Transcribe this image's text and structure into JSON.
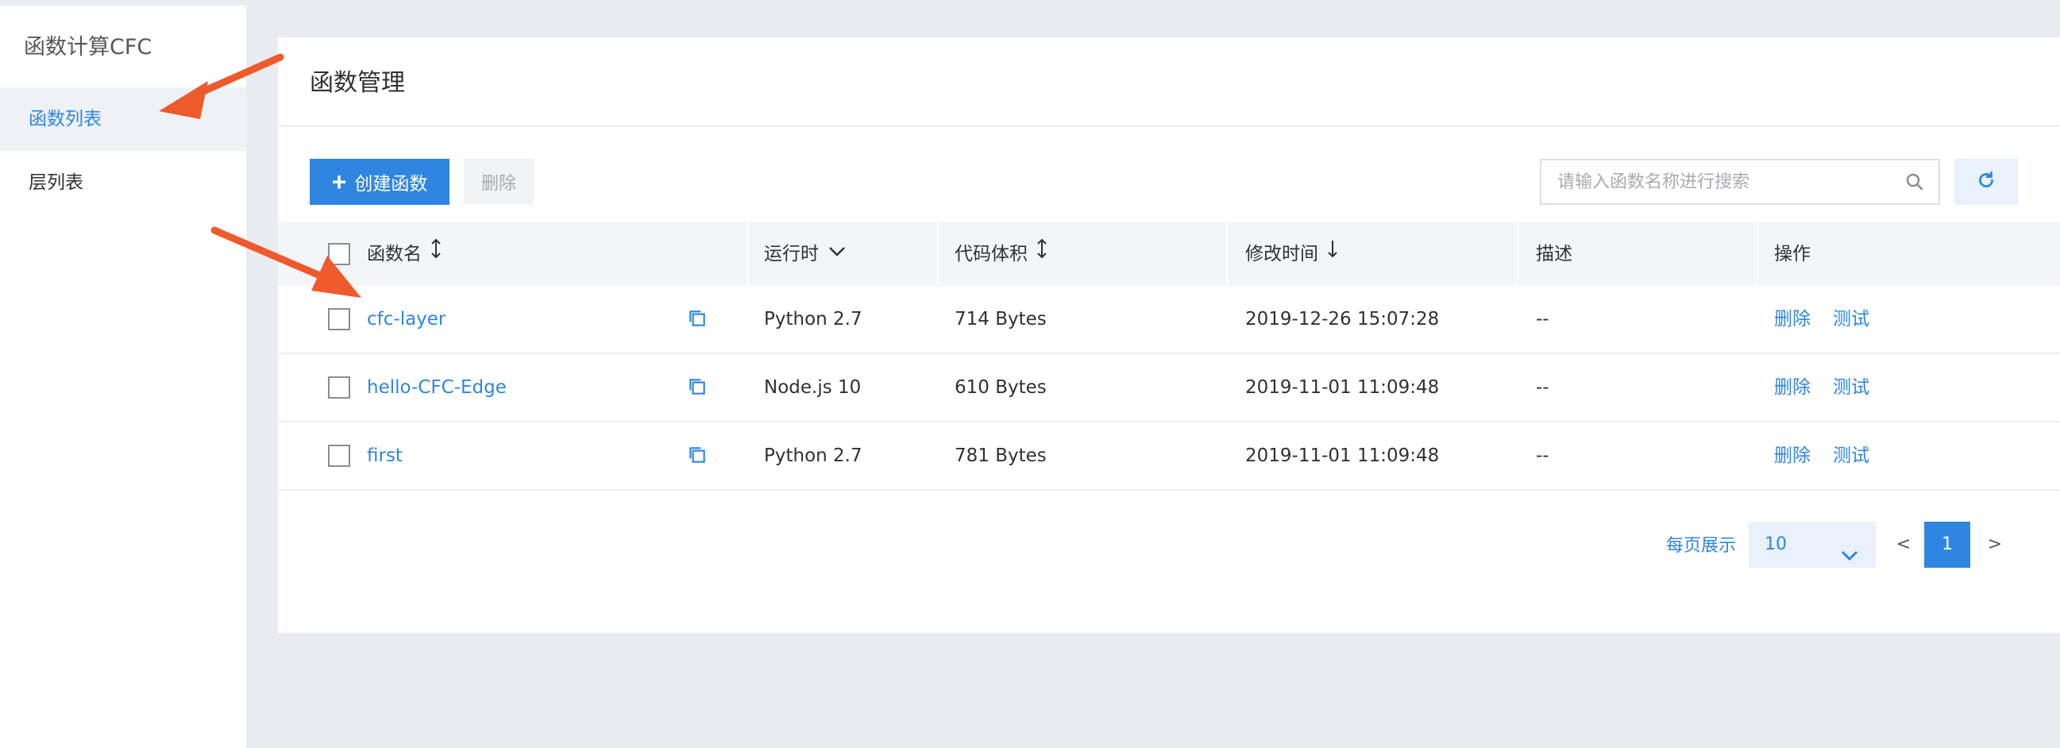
{
  "sidebar": {
    "title": "函数计算CFC",
    "items": [
      {
        "label": "函数列表",
        "active": true
      },
      {
        "label": "层列表",
        "active": false
      }
    ]
  },
  "main": {
    "title": "函数管理",
    "create_button": "创建函数",
    "delete_button": "删除",
    "search_placeholder": "请输入函数名称进行搜索",
    "columns": [
      "函数名",
      "运行时",
      "代码体积",
      "修改时间",
      "描述",
      "操作"
    ],
    "rows": [
      {
        "name": "cfc-layer",
        "runtime": "Python 2.7",
        "size": "714 Bytes",
        "modified": "2019-12-26 15:07:28",
        "desc": "--",
        "action_delete": "删除",
        "action_test": "测试"
      },
      {
        "name": "hello-CFC-Edge",
        "runtime": "Node.js 10",
        "size": "610 Bytes",
        "modified": "2019-11-01 11:09:48",
        "desc": "--",
        "action_delete": "删除",
        "action_test": "测试"
      },
      {
        "name": "first",
        "runtime": "Python 2.7",
        "size": "781 Bytes",
        "modified": "2019-11-01 11:09:48",
        "desc": "--",
        "action_delete": "删除",
        "action_test": "测试"
      }
    ],
    "pagination": {
      "label": "每页展示",
      "page_size": "10",
      "prev": "<",
      "current": "1",
      "next": ">"
    }
  },
  "colors": {
    "accent": "#2f86e0",
    "annotation_arrow": "#ee5a2b"
  },
  "icons": [
    "search-icon",
    "refresh-icon",
    "copy-icon",
    "sort-icon",
    "chevron-down-icon",
    "arrow-down-icon"
  ]
}
